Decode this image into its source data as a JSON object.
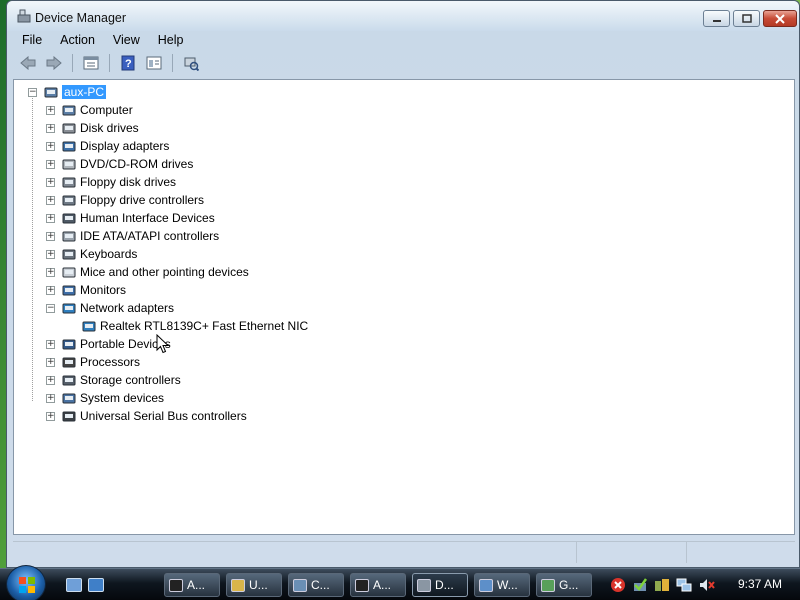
{
  "window": {
    "title": "Device Manager",
    "controls": {
      "minimize": "minimize",
      "maximize": "maximize",
      "close": "close"
    }
  },
  "menu": [
    "File",
    "Action",
    "View",
    "Help"
  ],
  "toolbar": {
    "buttons": [
      "back-arrow-icon",
      "forward-arrow-icon",
      "properties-icon",
      "help-icon",
      "view-icon",
      "scan-hardware-icon"
    ]
  },
  "tree": {
    "root": "aux-PC",
    "categories": [
      {
        "label": "Computer",
        "icon": "computer-icon",
        "expanded": false
      },
      {
        "label": "Disk drives",
        "icon": "disk-drive-icon",
        "expanded": false
      },
      {
        "label": "Display adapters",
        "icon": "display-adapter-icon",
        "expanded": false
      },
      {
        "label": "DVD/CD-ROM drives",
        "icon": "dvd-drive-icon",
        "expanded": false
      },
      {
        "label": "Floppy disk drives",
        "icon": "floppy-disk-icon",
        "expanded": false
      },
      {
        "label": "Floppy drive controllers",
        "icon": "floppy-controller-icon",
        "expanded": false
      },
      {
        "label": "Human Interface Devices",
        "icon": "hid-icon",
        "expanded": false
      },
      {
        "label": "IDE ATA/ATAPI controllers",
        "icon": "ide-controller-icon",
        "expanded": false
      },
      {
        "label": "Keyboards",
        "icon": "keyboard-icon",
        "expanded": false
      },
      {
        "label": "Mice and other pointing devices",
        "icon": "mouse-icon",
        "expanded": false
      },
      {
        "label": "Monitors",
        "icon": "monitor-icon",
        "expanded": false
      },
      {
        "label": "Network adapters",
        "icon": "network-adapter-icon",
        "expanded": true,
        "children": [
          "Realtek RTL8139C+ Fast Ethernet NIC"
        ]
      },
      {
        "label": "Portable Devices",
        "icon": "portable-device-icon",
        "expanded": false
      },
      {
        "label": "Processors",
        "icon": "processor-icon",
        "expanded": false
      },
      {
        "label": "Storage controllers",
        "icon": "storage-controller-icon",
        "expanded": false
      },
      {
        "label": "System devices",
        "icon": "system-device-icon",
        "expanded": false
      },
      {
        "label": "Universal Serial Bus controllers",
        "icon": "usb-icon",
        "expanded": false
      }
    ]
  },
  "taskbar": {
    "quick_launch": [
      "show-desktop-icon",
      "switch-windows-icon"
    ],
    "buttons": [
      {
        "label": "A...",
        "icon": "cmd-icon",
        "active": false
      },
      {
        "label": "U...",
        "icon": "folder-icon",
        "active": false
      },
      {
        "label": "C...",
        "icon": "settings-icon",
        "active": false
      },
      {
        "label": "A...",
        "icon": "cmd-icon",
        "active": false
      },
      {
        "label": "D...",
        "icon": "device-manager-icon",
        "active": true
      },
      {
        "label": "W...",
        "icon": "window-icon",
        "active": false
      },
      {
        "label": "G...",
        "icon": "app-icon",
        "active": false
      }
    ],
    "tray_icons": [
      "error-icon",
      "network-check-icon",
      "devices-icon",
      "network-icon",
      "volume-muted-icon"
    ],
    "clock": "9:37 AM"
  },
  "colors": {
    "selection": "#3399ff",
    "window_frame": "#cfdceb",
    "close_button": "#c74b36",
    "taskbar": "#0e161f"
  }
}
